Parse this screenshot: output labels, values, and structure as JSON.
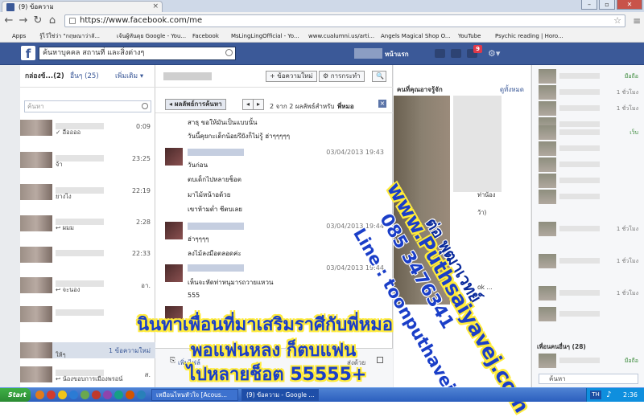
{
  "browser": {
    "tab_title": "(9) ข้อความ",
    "url": "https://www.facebook.com/me",
    "bookmarks": [
      {
        "label": "Apps",
        "color": "#3b5998"
      },
      {
        "label": "รู้ไว้ใช่ว่า \"กฤษณาว่าลั...",
        "color": "#c0392b"
      },
      {
        "label": "เจ้นผู้หันดุย Google - You...",
        "color": "#c4302b"
      },
      {
        "label": "Facebook",
        "color": "#3b5998"
      },
      {
        "label": "MsLingLingOfficial - Yo...",
        "color": "#c4302b"
      },
      {
        "label": "www.cualumni.us/arti...",
        "color": "#999999"
      },
      {
        "label": "Angels Magical Shop O...",
        "color": "#d4801c"
      },
      {
        "label": "YouTube",
        "color": "#c4302b"
      },
      {
        "label": "Psychic reading | Horo...",
        "color": "#7a5230"
      }
    ]
  },
  "facebook": {
    "search_placeholder": "ค้นหาบุคคล สถานที่ และสิ่งต่างๆ",
    "home_label": "หน้าแรก",
    "notif_count": "9",
    "left": {
      "inbox_label": "กล่องข้...(2)",
      "other_label": "อื่นๆ (25)",
      "more_label": "เพิ่มเติม ▾",
      "search_placeholder": "ค้นหา",
      "conversations": [
        {
          "time": "0:09",
          "preview": "✓ อืออออ"
        },
        {
          "time": "23:25",
          "preview": "จ้า"
        },
        {
          "time": "22:19",
          "preview": "ยางไง"
        },
        {
          "time": "2:28",
          "preview": "↩ ผมม"
        },
        {
          "time": "22:33",
          "preview": ""
        },
        {
          "time": "อา.",
          "preview": "↩ จะนอง"
        },
        {
          "time": "",
          "preview": ""
        },
        {
          "time": "",
          "preview": "ให้ๆ",
          "new_label": "1 ข้อความใหม่"
        },
        {
          "time": "ส.",
          "preview": ""
        },
        {
          "time": "ส.",
          "preview": "↩ น้องขอบการเมืองพรอน์"
        }
      ]
    },
    "middle": {
      "new_message_btn": "+ ข้อความใหม่",
      "actions_btn": "⚙ การกระทำ",
      "back_btn": "◂ ผลลัพธ์การค้นหา",
      "result_text": "2 จาก 2 ผลลัพธ์สำหรับ",
      "result_query": "พี่หมอ",
      "messages": [
        "สาธุ ขอให้มันเป็นแบบนั้น",
        "วันนี้คุยกะเด็กน้อยรึยังก็ไม่รู้ ฮ่าๆๆๆๆๆ",
        "วันก่อน",
        "ตบเด็กไปหลายช็อต",
        "มาไม้หน้าอด้วย",
        "เขาห้ามต่ำ ชีตบเลย",
        "ฮ่าๆๆๆๆ",
        "ลงไม้ลงมือตลอดค่ะ",
        "เห็นจะหัดท่าหนุมารถวายแหวน",
        "555"
      ],
      "dates": [
        "03/04/2013 19:43",
        "03/04/2013 19:44",
        "03/04/2013 19:44"
      ],
      "attach_label": "เพิ่มไฟล์",
      "enter_label": "ส่งด้วย"
    },
    "right": {
      "title": "คนที่คุณอาจรู้จัก",
      "see_all": "ดูทั้งหมด",
      "snippets": [
        "ท่าน้อง",
        "ว้า)",
        "ok ..."
      ]
    },
    "chat": {
      "friends_label": "เพื่อนคนอื่นๆ (28)",
      "search_placeholder": "ค้นหา",
      "statuses": [
        "มือถือ",
        "1 ชั่วโมง",
        "1 ชั่วโมง",
        "",
        "เว็บ",
        "",
        "",
        "",
        "",
        "1 ชั่วโมง",
        "",
        "1 ชั่วโมง",
        "",
        "1 ชั่วโมง",
        "",
        "",
        "",
        "",
        ""
      ]
    }
  },
  "overlay": {
    "line1": "ต่อ พุฒาเวทย์",
    "line2": "www.Puthsaiyavej.com",
    "line3": "085 3476341",
    "line4": "Line : toonputhavej",
    "big1": "นินทาเพื่อนที่มาเสริมราศีกับพี่หมอ",
    "big2": "พอแฟนหลง ก็ตบแฟน",
    "big3": "ไปหลายช็อต 55555+"
  },
  "taskbar": {
    "start": "Start",
    "task1": "เหมือนไหนหัวใจ [Acous...",
    "task2": "(9) ข้อความ - Google ...",
    "tray_icon": "TH",
    "time": "2:36"
  }
}
